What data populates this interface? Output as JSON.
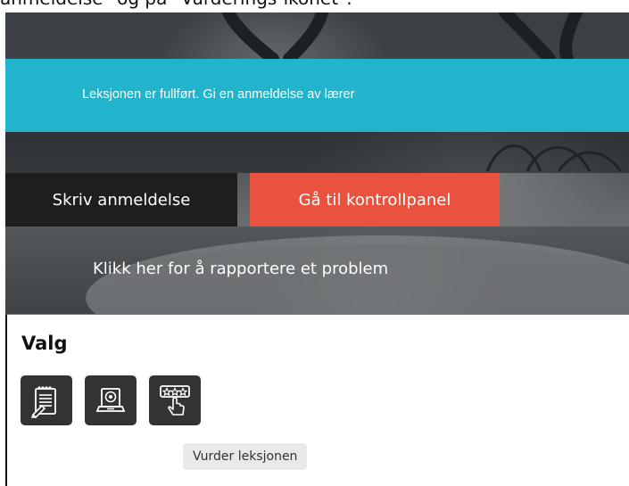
{
  "caption_partial": "anmeldelse\" og på \"Vurderings-ikonet\".",
  "banner": {
    "text": "Leksjonen er fullført. Gi en anmeldelse av lærer"
  },
  "buttons": {
    "write_review": "Skriv anmeldelse",
    "go_dashboard": "Gå til kontrollpanel"
  },
  "report_link": "Klikk her for å rapportere et problem",
  "colors": {
    "banner": "#23b4cd",
    "dashboard_button": "#e8523f",
    "review_button": "#1e1e1e",
    "option_icon_bg": "#333333"
  },
  "options": {
    "title": "Valg",
    "icons": [
      {
        "icon": "notepad-pen-icon"
      },
      {
        "icon": "laptop-settings-icon"
      },
      {
        "icon": "rating-stars-hand-icon"
      }
    ],
    "tooltip": "Vurder leksjonen"
  }
}
